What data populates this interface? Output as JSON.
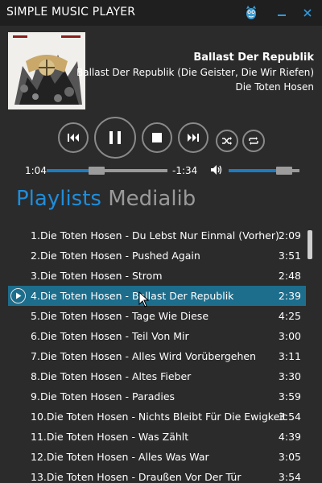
{
  "window": {
    "title": "SIMPLE MUSIC PLAYER",
    "min_icon": "minimize-icon",
    "close_icon": "close-icon"
  },
  "now_playing": {
    "title": "Ballast Der Republik",
    "album": "Ballast Der Republik (Die Geister, Die Wir Riefen)",
    "artist": "Die Toten Hosen"
  },
  "controls": {
    "previous": "previous-icon",
    "pause": "pause-icon",
    "stop": "stop-icon",
    "next": "next-icon",
    "shuffle": "shuffle-icon",
    "repeat": "repeat-icon"
  },
  "progress": {
    "elapsed": "1:04",
    "remaining": "-1:34",
    "fraction": 0.41
  },
  "volume": {
    "icon": "volume-icon",
    "level": 0.78
  },
  "tabs": [
    {
      "label": "Playlists",
      "active": true
    },
    {
      "label": "Medialib",
      "active": false
    }
  ],
  "playlist": {
    "current_index": 3,
    "tracks": [
      {
        "no": "1.",
        "title": "Die Toten Hosen - Du Lebst Nur Einmal (Vorher)",
        "duration": "2:09"
      },
      {
        "no": "2.",
        "title": "Die Toten Hosen - Pushed Again",
        "duration": "3:51"
      },
      {
        "no": "3.",
        "title": "Die Toten Hosen - Strom",
        "duration": "2:48"
      },
      {
        "no": "4.",
        "title": "Die Toten Hosen - Ballast Der Republik",
        "duration": "2:39"
      },
      {
        "no": "5.",
        "title": "Die Toten Hosen - Tage Wie Diese",
        "duration": "4:25"
      },
      {
        "no": "6.",
        "title": "Die Toten Hosen - Teil Von Mir",
        "duration": "3:00"
      },
      {
        "no": "7.",
        "title": "Die Toten Hosen - Alles Wird Vorübergehen",
        "duration": "3:11"
      },
      {
        "no": "8.",
        "title": "Die Toten Hosen - Altes Fieber",
        "duration": "3:30"
      },
      {
        "no": "9.",
        "title": "Die Toten Hosen - Paradies",
        "duration": "3:59"
      },
      {
        "no": "10.",
        "title": "Die Toten Hosen - Nichts Bleibt Für Die Ewigkeit",
        "duration": "3:54"
      },
      {
        "no": "11.",
        "title": "Die Toten Hosen - Was Zählt",
        "duration": "4:39"
      },
      {
        "no": "12.",
        "title": "Die Toten Hosen - Alles Was War",
        "duration": "3:05"
      },
      {
        "no": "13.",
        "title": "Die Toten Hosen - Draußen Vor Der Tür",
        "duration": "3:54"
      }
    ]
  },
  "colors": {
    "accent": "#1f8ddc",
    "selected_row": "#1d6d8c",
    "progress_fill": "#1e7bbf",
    "background": "#2b2b2b"
  }
}
